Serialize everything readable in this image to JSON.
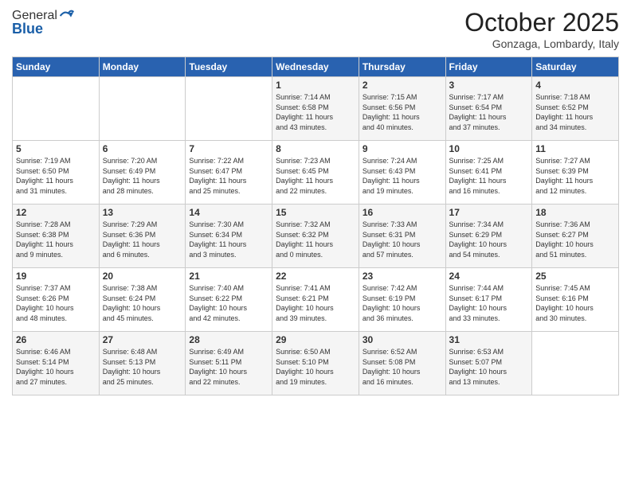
{
  "header": {
    "logo_line1": "General",
    "logo_line2": "Blue",
    "month": "October 2025",
    "location": "Gonzaga, Lombardy, Italy"
  },
  "days_of_week": [
    "Sunday",
    "Monday",
    "Tuesday",
    "Wednesday",
    "Thursday",
    "Friday",
    "Saturday"
  ],
  "weeks": [
    [
      {
        "day": "",
        "info": ""
      },
      {
        "day": "",
        "info": ""
      },
      {
        "day": "",
        "info": ""
      },
      {
        "day": "1",
        "info": "Sunrise: 7:14 AM\nSunset: 6:58 PM\nDaylight: 11 hours\nand 43 minutes."
      },
      {
        "day": "2",
        "info": "Sunrise: 7:15 AM\nSunset: 6:56 PM\nDaylight: 11 hours\nand 40 minutes."
      },
      {
        "day": "3",
        "info": "Sunrise: 7:17 AM\nSunset: 6:54 PM\nDaylight: 11 hours\nand 37 minutes."
      },
      {
        "day": "4",
        "info": "Sunrise: 7:18 AM\nSunset: 6:52 PM\nDaylight: 11 hours\nand 34 minutes."
      }
    ],
    [
      {
        "day": "5",
        "info": "Sunrise: 7:19 AM\nSunset: 6:50 PM\nDaylight: 11 hours\nand 31 minutes."
      },
      {
        "day": "6",
        "info": "Sunrise: 7:20 AM\nSunset: 6:49 PM\nDaylight: 11 hours\nand 28 minutes."
      },
      {
        "day": "7",
        "info": "Sunrise: 7:22 AM\nSunset: 6:47 PM\nDaylight: 11 hours\nand 25 minutes."
      },
      {
        "day": "8",
        "info": "Sunrise: 7:23 AM\nSunset: 6:45 PM\nDaylight: 11 hours\nand 22 minutes."
      },
      {
        "day": "9",
        "info": "Sunrise: 7:24 AM\nSunset: 6:43 PM\nDaylight: 11 hours\nand 19 minutes."
      },
      {
        "day": "10",
        "info": "Sunrise: 7:25 AM\nSunset: 6:41 PM\nDaylight: 11 hours\nand 16 minutes."
      },
      {
        "day": "11",
        "info": "Sunrise: 7:27 AM\nSunset: 6:39 PM\nDaylight: 11 hours\nand 12 minutes."
      }
    ],
    [
      {
        "day": "12",
        "info": "Sunrise: 7:28 AM\nSunset: 6:38 PM\nDaylight: 11 hours\nand 9 minutes."
      },
      {
        "day": "13",
        "info": "Sunrise: 7:29 AM\nSunset: 6:36 PM\nDaylight: 11 hours\nand 6 minutes."
      },
      {
        "day": "14",
        "info": "Sunrise: 7:30 AM\nSunset: 6:34 PM\nDaylight: 11 hours\nand 3 minutes."
      },
      {
        "day": "15",
        "info": "Sunrise: 7:32 AM\nSunset: 6:32 PM\nDaylight: 11 hours\nand 0 minutes."
      },
      {
        "day": "16",
        "info": "Sunrise: 7:33 AM\nSunset: 6:31 PM\nDaylight: 10 hours\nand 57 minutes."
      },
      {
        "day": "17",
        "info": "Sunrise: 7:34 AM\nSunset: 6:29 PM\nDaylight: 10 hours\nand 54 minutes."
      },
      {
        "day": "18",
        "info": "Sunrise: 7:36 AM\nSunset: 6:27 PM\nDaylight: 10 hours\nand 51 minutes."
      }
    ],
    [
      {
        "day": "19",
        "info": "Sunrise: 7:37 AM\nSunset: 6:26 PM\nDaylight: 10 hours\nand 48 minutes."
      },
      {
        "day": "20",
        "info": "Sunrise: 7:38 AM\nSunset: 6:24 PM\nDaylight: 10 hours\nand 45 minutes."
      },
      {
        "day": "21",
        "info": "Sunrise: 7:40 AM\nSunset: 6:22 PM\nDaylight: 10 hours\nand 42 minutes."
      },
      {
        "day": "22",
        "info": "Sunrise: 7:41 AM\nSunset: 6:21 PM\nDaylight: 10 hours\nand 39 minutes."
      },
      {
        "day": "23",
        "info": "Sunrise: 7:42 AM\nSunset: 6:19 PM\nDaylight: 10 hours\nand 36 minutes."
      },
      {
        "day": "24",
        "info": "Sunrise: 7:44 AM\nSunset: 6:17 PM\nDaylight: 10 hours\nand 33 minutes."
      },
      {
        "day": "25",
        "info": "Sunrise: 7:45 AM\nSunset: 6:16 PM\nDaylight: 10 hours\nand 30 minutes."
      }
    ],
    [
      {
        "day": "26",
        "info": "Sunrise: 6:46 AM\nSunset: 5:14 PM\nDaylight: 10 hours\nand 27 minutes."
      },
      {
        "day": "27",
        "info": "Sunrise: 6:48 AM\nSunset: 5:13 PM\nDaylight: 10 hours\nand 25 minutes."
      },
      {
        "day": "28",
        "info": "Sunrise: 6:49 AM\nSunset: 5:11 PM\nDaylight: 10 hours\nand 22 minutes."
      },
      {
        "day": "29",
        "info": "Sunrise: 6:50 AM\nSunset: 5:10 PM\nDaylight: 10 hours\nand 19 minutes."
      },
      {
        "day": "30",
        "info": "Sunrise: 6:52 AM\nSunset: 5:08 PM\nDaylight: 10 hours\nand 16 minutes."
      },
      {
        "day": "31",
        "info": "Sunrise: 6:53 AM\nSunset: 5:07 PM\nDaylight: 10 hours\nand 13 minutes."
      },
      {
        "day": "",
        "info": ""
      }
    ]
  ]
}
